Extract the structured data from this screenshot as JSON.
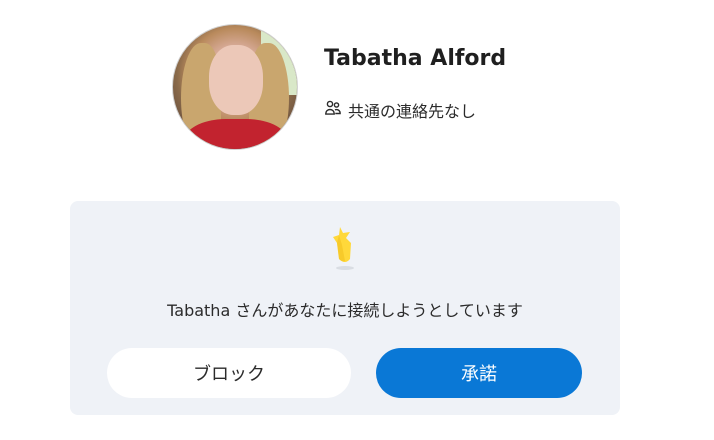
{
  "profile": {
    "name": "Tabatha Alford",
    "mutual_contacts": "共通の連絡先なし",
    "mutual_icon": "people-icon",
    "avatar_icon": "profile-photo"
  },
  "request": {
    "illustration": "star-icon",
    "message": "Tabatha さんがあなたに接続しようとしています",
    "block_label": "ブロック",
    "accept_label": "承諾"
  },
  "colors": {
    "card_background": "#eff2f7",
    "accept_button": "#0a78d6",
    "block_button": "#ffffff",
    "star": "#ffd83a"
  }
}
